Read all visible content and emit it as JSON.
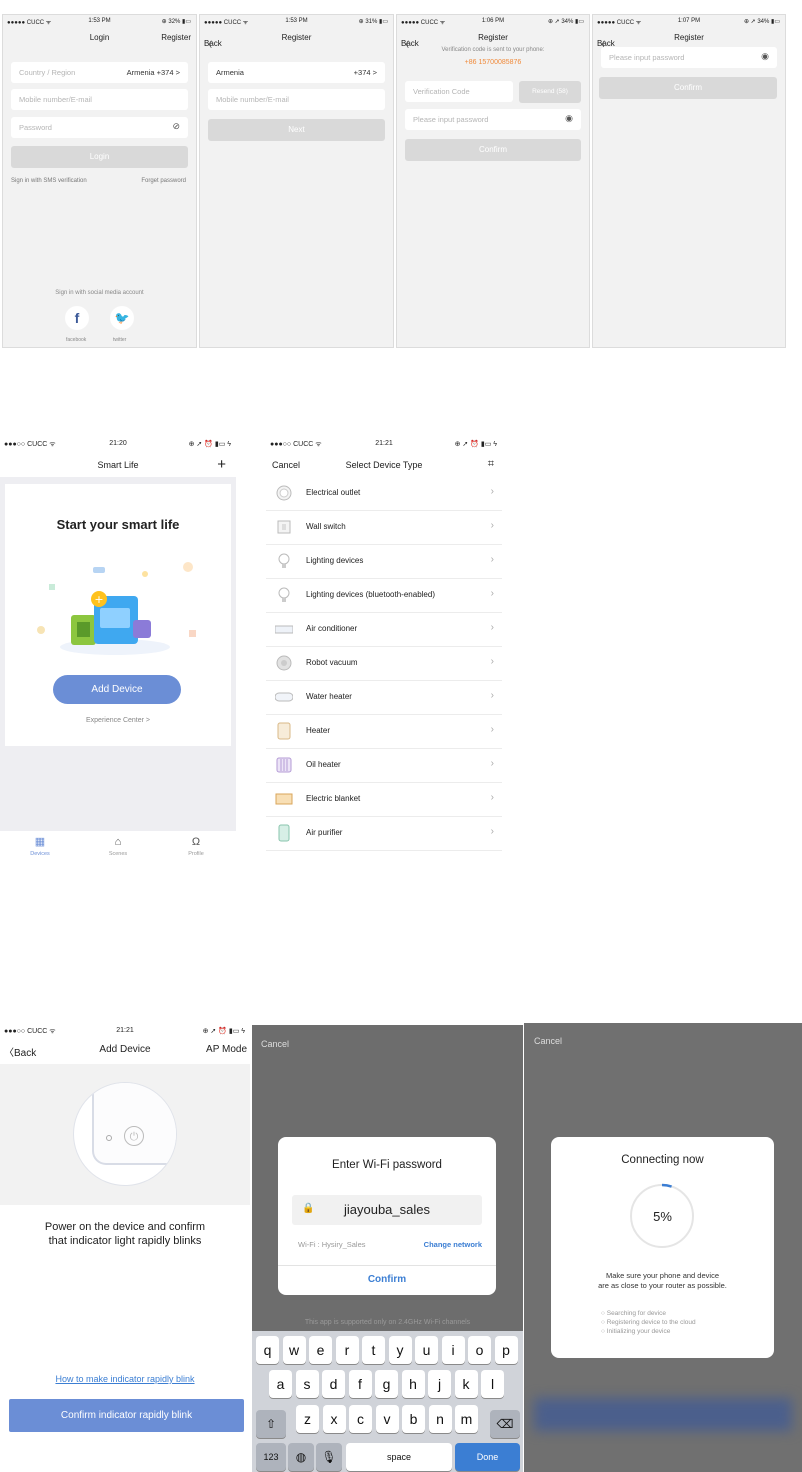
{
  "status": {
    "carrier": "●●●●● CUCC ᯤ",
    "carrier_b": "●●●○○ CUCC ᯤ",
    "time_s1": "1:53 PM",
    "bat_s1": "⊕ 32% ▮▭",
    "time_s2": "1:53 PM",
    "bat_s2": "⊕ 31% ▮▭",
    "time_s3": "1:06 PM",
    "bat_s3": "⊕ ➚ 34% ▮▭",
    "time_s4": "1:07 PM",
    "bat_s4": "⊕ ➚ 34% ▮▭",
    "time_s5": "21:20",
    "time_s6": "21:21",
    "time_s7": "21:21",
    "bat_b": "⊕ ➚ ⏰ ▮▭ ϟ"
  },
  "login": {
    "title": "Login",
    "register": "Register",
    "country_placeholder": "Country / Region",
    "country_value": "Armenia +374 >",
    "mobile_placeholder": "Mobile number/E-mail",
    "password_placeholder": "Password",
    "login_button": "Login",
    "sms_link": "Sign in with SMS verification",
    "forgot_link": "Forget password",
    "social_title": "Sign in with social media account",
    "facebook": "facebook",
    "twitter": "twitter"
  },
  "register1": {
    "back": "Back",
    "title": "Register",
    "country": "Armenia",
    "code": "+374 >",
    "mobile_placeholder": "Mobile number/E-mail",
    "next": "Next"
  },
  "register2": {
    "back": "Back",
    "title": "Register",
    "sent_note": "Verification code is sent to your phone:",
    "phone": "+86 15700085876",
    "code_placeholder": "Verification Code",
    "resend": "Resend (58)",
    "password_placeholder": "Please input password",
    "confirm": "Confirm"
  },
  "register3": {
    "back": "Back",
    "title": "Register",
    "password_placeholder": "Please input password",
    "confirm": "Confirm"
  },
  "home": {
    "title": "Smart Life",
    "plus": "+",
    "headline": "Start your smart life",
    "add_device": "Add Device",
    "experience": "Experience Center >",
    "tabs": [
      "Devices",
      "Scenes",
      "Profile"
    ]
  },
  "select": {
    "cancel": "Cancel",
    "title": "Select Device Type",
    "items": [
      "Electrical outlet",
      "Wall switch",
      "Lighting devices",
      "Lighting devices (bluetooth-enabled)",
      "Air conditioner",
      "Robot vacuum",
      "Water heater",
      "Heater",
      "Oil heater",
      "Electric blanket",
      "Air purifier"
    ]
  },
  "add": {
    "back": "Back",
    "title": "Add Device",
    "mode": "AP Mode",
    "instruction_1": "Power on the device and confirm",
    "instruction_2": "that indicator light rapidly blinks",
    "help_link": "How to make indicator rapidly blink",
    "confirm": "Confirm indicator rapidly blink"
  },
  "wifi": {
    "cancel": "Cancel",
    "title": "Enter Wi-Fi password",
    "ssid_value": "jiayouba_sales",
    "wifi_label": "Wi-Fi : Hysiry_Sales",
    "change": "Change network",
    "confirm": "Confirm",
    "note": "This app is supported only on 2.4GHz Wi-Fi channels",
    "row1": [
      "q",
      "w",
      "e",
      "r",
      "t",
      "y",
      "u",
      "i",
      "o",
      "p"
    ],
    "row2": [
      "a",
      "s",
      "d",
      "f",
      "g",
      "h",
      "j",
      "k",
      "l"
    ],
    "row3": [
      "z",
      "x",
      "c",
      "v",
      "b",
      "n",
      "m"
    ],
    "k123": "123",
    "space": "space",
    "done": "Done"
  },
  "connect": {
    "cancel": "Cancel",
    "title": "Connecting now",
    "percent": "5%",
    "progress_fraction": 0.05,
    "note_1": "Make sure your phone and device",
    "note_2": "are as close to your router as possible.",
    "steps": [
      "Searching for device",
      "Registering device to the cloud",
      "Initializing your device"
    ]
  },
  "colors": {
    "accent_blue": "#6b8ed6",
    "orange": "#f08a3a",
    "link_blue": "#3b7ed3",
    "disabled": "#d9d9d9"
  }
}
